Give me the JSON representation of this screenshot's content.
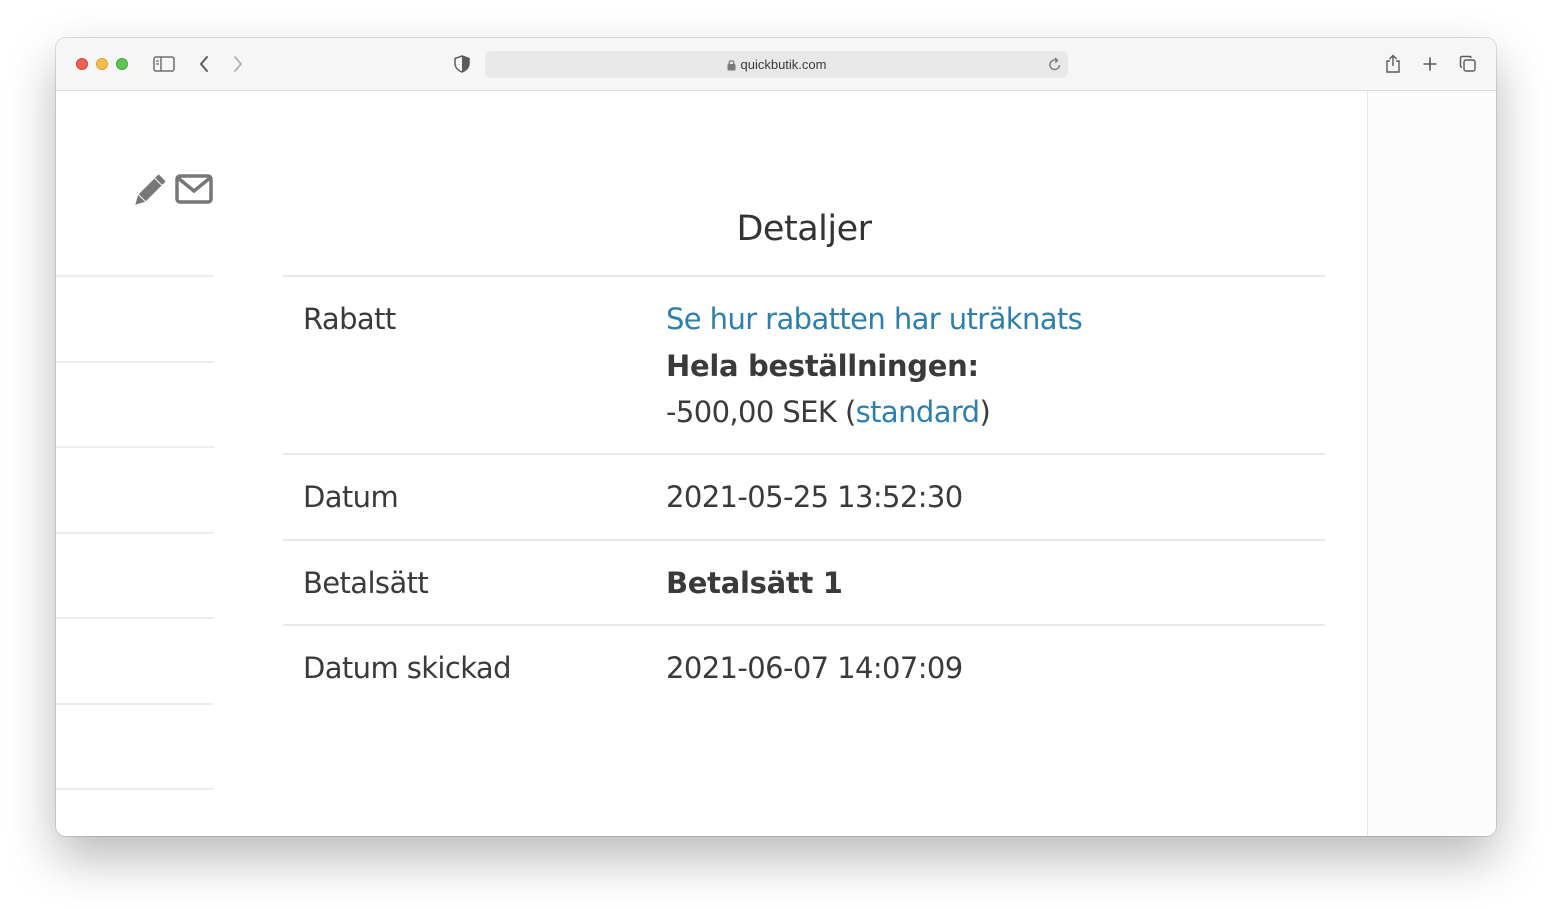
{
  "browser": {
    "url": "quickbutik.com"
  },
  "page": {
    "title": "Detaljer",
    "rows": [
      {
        "label": "Rabatt",
        "link": "Se hur rabatten har uträknats",
        "scope": "Hela beställningen:",
        "amount": "-500,00 SEK",
        "open_paren": "(",
        "code": "standard",
        "close_paren": ")"
      },
      {
        "label": "Datum",
        "value": "2021-05-25 13:52:30"
      },
      {
        "label": "Betalsätt",
        "value": "Betalsätt 1"
      },
      {
        "label": "Datum skickad",
        "value": "2021-06-07 14:07:09"
      }
    ]
  },
  "icons": {
    "edit": "pencil-icon",
    "email": "envelope-icon"
  },
  "colors": {
    "link": "#2d7fae",
    "text": "#3a3a3a"
  }
}
